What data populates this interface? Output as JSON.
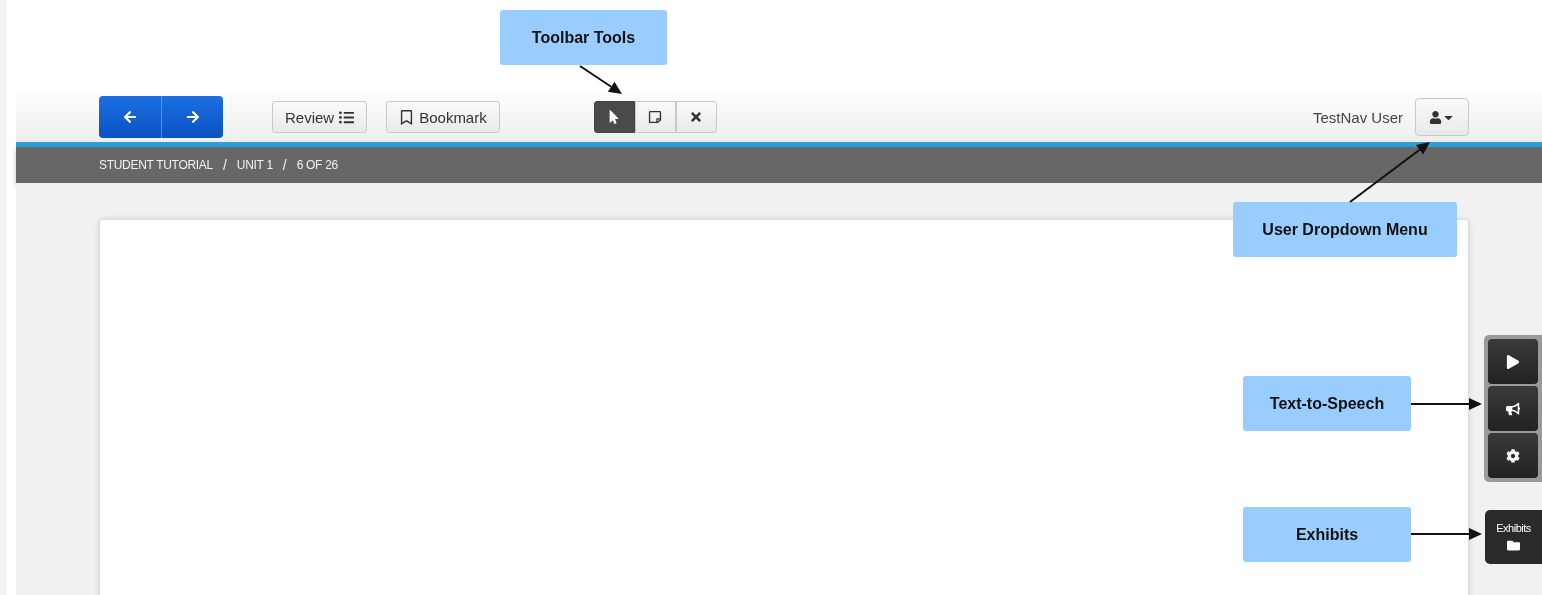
{
  "toolbar": {
    "nav": [
      {
        "kind": "back"
      },
      {
        "kind": "next"
      }
    ],
    "review": "Review",
    "bookmark": "Bookmark",
    "tools": [
      {
        "kind": "pointer",
        "selected": true
      },
      {
        "kind": "note",
        "selected": false
      },
      {
        "kind": "eliminate",
        "selected": false
      }
    ],
    "user": "TestNav User"
  },
  "breadcrumb": [
    "STUDENT TUTORIAL",
    "UNIT 1",
    "6 OF 26"
  ],
  "breadcrumb_separator": "/",
  "side_tools": [
    {
      "kind": "play"
    },
    {
      "kind": "speaker"
    },
    {
      "kind": "settings"
    }
  ],
  "exhibits": "Exhibits",
  "callouts": [
    {
      "kind": "toolbar",
      "label": "Toolbar Tools"
    },
    {
      "kind": "user",
      "label": "User Dropdown Menu"
    },
    {
      "kind": "speech",
      "label": "Text-to-Speech"
    },
    {
      "kind": "exhibits",
      "label": "Exhibits"
    }
  ]
}
